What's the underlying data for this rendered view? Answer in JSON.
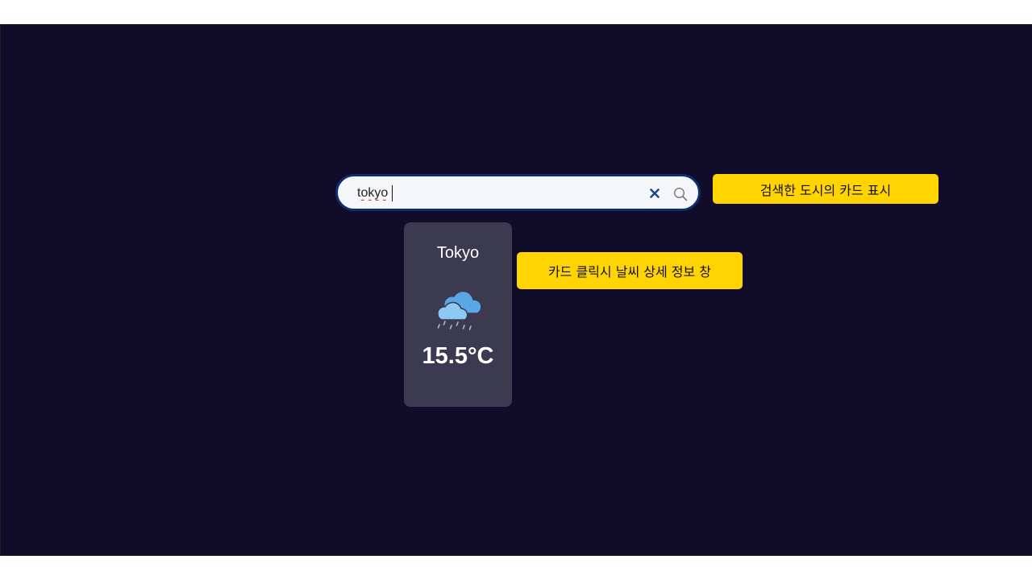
{
  "search": {
    "value": "tokyo",
    "clear_icon": "close-icon",
    "search_icon": "search-icon"
  },
  "card": {
    "city": "Tokyo",
    "icon": "cloud-rain-icon",
    "temperature": "15.5°C"
  },
  "annotations": {
    "search_note": "검색한 도시의 카드 표시",
    "card_note": "카드 클릭시 날씨 상세 정보 창"
  },
  "colors": {
    "background": "#110c29",
    "search_border": "#0f2c6e",
    "card_bg": "#3b3a50",
    "note_bg": "#ffd400",
    "clear_icon": "#1e4a8c"
  }
}
